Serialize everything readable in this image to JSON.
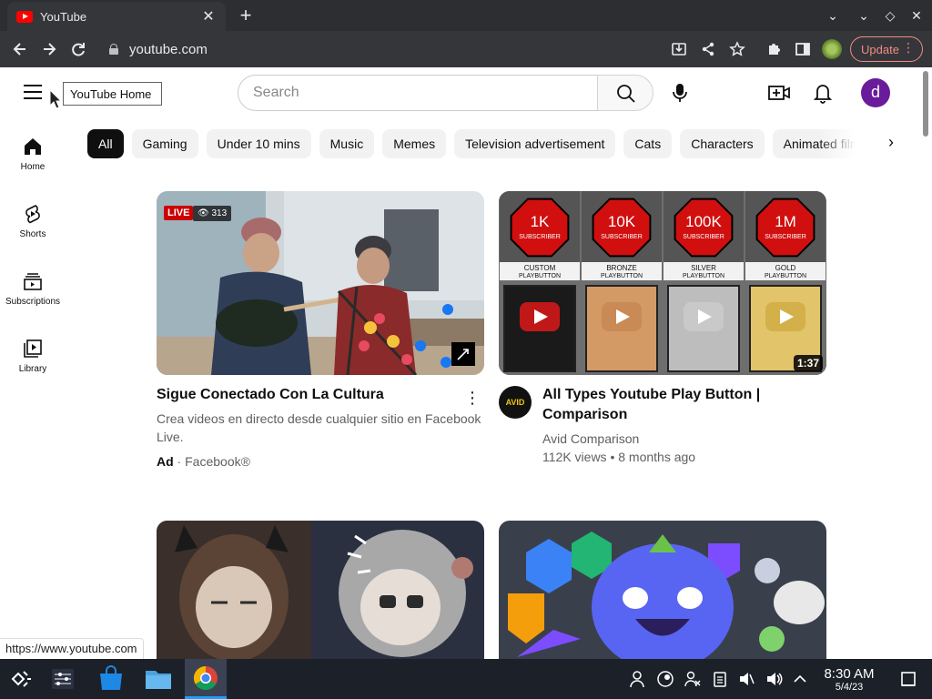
{
  "browser": {
    "tab_title": "YouTube",
    "url": "youtube.com",
    "update_label": "Update"
  },
  "header": {
    "tooltip": "YouTube Home",
    "search_placeholder": "Search",
    "avatar_letter": "d"
  },
  "sidebar": {
    "items": [
      {
        "label": "Home",
        "icon": "home-icon"
      },
      {
        "label": "Shorts",
        "icon": "shorts-icon"
      },
      {
        "label": "Subscriptions",
        "icon": "subscriptions-icon"
      },
      {
        "label": "Library",
        "icon": "library-icon"
      }
    ]
  },
  "chips": [
    "All",
    "Gaming",
    "Under 10 mins",
    "Music",
    "Memes",
    "Television advertisement",
    "Cats",
    "Characters",
    "Animated films"
  ],
  "videos": [
    {
      "title": "Sigue Conectado Con La Cultura",
      "description": "Crea videos en directo desde cualquier sitio en Facebook Live.",
      "ad_label": "Ad",
      "advertiser": "Facebook®",
      "live": "LIVE",
      "viewers": "313"
    },
    {
      "title_line1": "All Types Youtube Play Button |",
      "title_line2": "Comparison",
      "channel": "Avid Comparison",
      "stats": "112K views • 8 months ago",
      "duration": "1:37",
      "channel_avatar_text": "AVID",
      "thumb_tiers": [
        {
          "count": "1K",
          "label": "SUBSCRIBER",
          "name": "CUSTOM",
          "sub": "PLAYBUTTON"
        },
        {
          "count": "10K",
          "label": "SUBSCRIBER",
          "name": "BRONZE",
          "sub": "PLAYBUTTON"
        },
        {
          "count": "100K",
          "label": "SUBSCRIBER",
          "name": "SILVER",
          "sub": "PLAYBUTTON"
        },
        {
          "count": "1M",
          "label": "SUBSCRIBER",
          "name": "GOLD",
          "sub": "PLAYBUTTON"
        }
      ]
    }
  ],
  "status_url": "https://www.youtube.com",
  "taskbar": {
    "time": "8:30 AM",
    "date": "5/4/23"
  },
  "colors": {
    "youtube_red": "#ff0000",
    "chrome_dark": "#35363a",
    "avatar_purple": "#6a1b9a",
    "taskbar_bg": "#1c2029"
  }
}
